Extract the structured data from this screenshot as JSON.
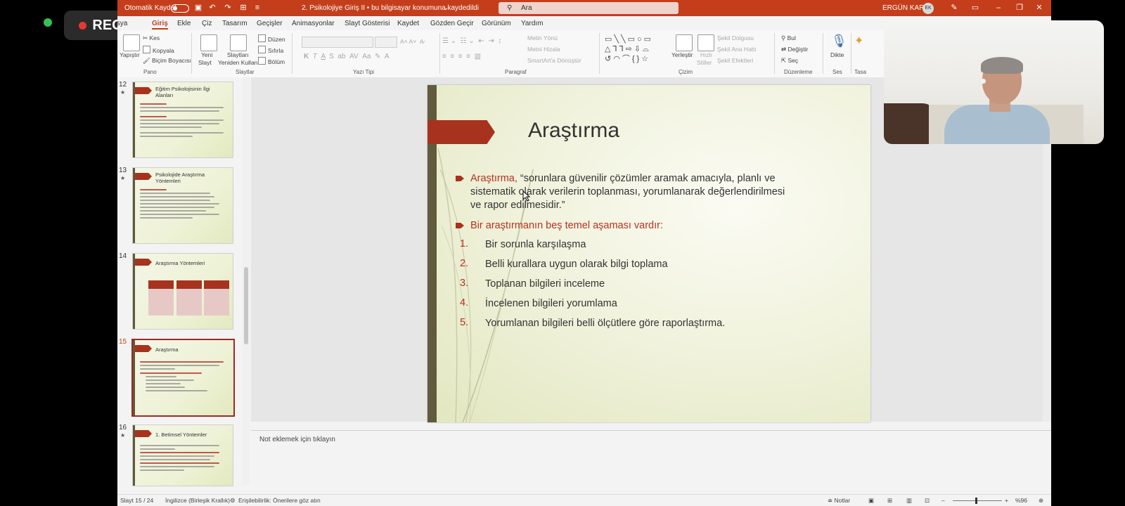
{
  "recording": {
    "label": "REC"
  },
  "titlebar": {
    "autosave_label": "Otomatik Kaydet",
    "document_title": "2. Psikolojiye Giriş II  •  bu bilgisayar konumuna kaydedildi",
    "search_placeholder": "Ara",
    "user_name": "ERGÜN KARA",
    "user_initials": "EK"
  },
  "ribbon_tabs": [
    "Dosya",
    "Giriş",
    "Ekle",
    "Çiz",
    "Tasarım",
    "Geçişler",
    "Animasyonlar",
    "Slayt Gösterisi",
    "Kaydet",
    "Gözden Geçir",
    "Görünüm",
    "Yardım"
  ],
  "ribbon": {
    "pano": {
      "paste": "Yapıştır",
      "cut": "Kes",
      "copy": "Kopyala",
      "format_painter": "Biçim Boyacısı",
      "label": "Pano"
    },
    "slaytlar": {
      "new_slide": "Yeni",
      "new_slide2": "Slayt",
      "reuse": "Slaytları",
      "reuse2": "Yeniden Kullan",
      "layout": "Düzen",
      "reset": "Sıfırla",
      "section": "Bölüm",
      "label": "Slaytlar"
    },
    "yazi_tipi": {
      "label": "Yazı Tipi"
    },
    "paragraf": {
      "text_direction": "Metin Yönü",
      "align_text": "Metni Hizala",
      "smartart": "SmartArt'a Dönüştür",
      "label": "Paragraf"
    },
    "cizim": {
      "arrange": "Yerleştir",
      "quick_styles": "Hızlı",
      "quick_styles2": "Stiller",
      "shape_fill": "Şekil Dolgusu",
      "shape_outline": "Şekil Ana Hattı",
      "shape_effects": "Şekil Efektleri",
      "label": "Çizim"
    },
    "duzenleme": {
      "find": "Bul",
      "replace": "Değiştir",
      "select": "Seç",
      "label": "Düzenleme"
    },
    "ses": {
      "dictate": "Dikte",
      "label": "Ses"
    },
    "tasarimci": {
      "label": "Tasa"
    }
  },
  "thumbnails": [
    {
      "number": "12",
      "title": "Eğitim Psikolojisinin İlgi Alanları",
      "selected": false
    },
    {
      "number": "13",
      "title": "Psikolojide Araştırma Yöntemleri",
      "selected": false
    },
    {
      "number": "14",
      "title": "Araştırma Yöntemleri",
      "selected": false
    },
    {
      "number": "15",
      "title": "Araştırma",
      "selected": true
    },
    {
      "number": "16",
      "title": "1. Betimsel Yöntemler",
      "selected": false
    }
  ],
  "slide": {
    "title": "Araştırma",
    "bullet1_red": "Araştırma,",
    "bullet1_line1": " “sorunlara güvenilir çözümler aramak amacıyla, planlı ve",
    "bullet1_line2": "sistematik olarak verilerin toplanması, yorumlanarak değerlendirilmesi",
    "bullet1_line3": "ve rapor edilmesidir.”",
    "bullet2": "Bir araştırmanın beş temel aşaması vardır:",
    "steps": [
      {
        "n": "1.",
        "text": "Bir sorunla karşılaşma"
      },
      {
        "n": "2.",
        "text": "Belli kurallara uygun olarak bilgi toplama"
      },
      {
        "n": "3.",
        "text": "Toplanan bilgileri inceleme"
      },
      {
        "n": "4.",
        "text": "İncelenen bilgileri yorumlama"
      },
      {
        "n": "5.",
        "text": "Yorumlanan bilgileri belli ölçütlere göre raporlaştırma."
      }
    ]
  },
  "notes": {
    "placeholder": "Not eklemek için tıklayın"
  },
  "status": {
    "slide_counter": "Slayt 15 / 24",
    "language": "İngilizce (Birleşik Krallık)",
    "accessibility": "Erişilebilirlik: Önerilere göz atın",
    "notes_button": "Notlar",
    "zoom": "%96"
  },
  "colors": {
    "accent": "#c43e1c",
    "slide_red": "#a7321e"
  }
}
